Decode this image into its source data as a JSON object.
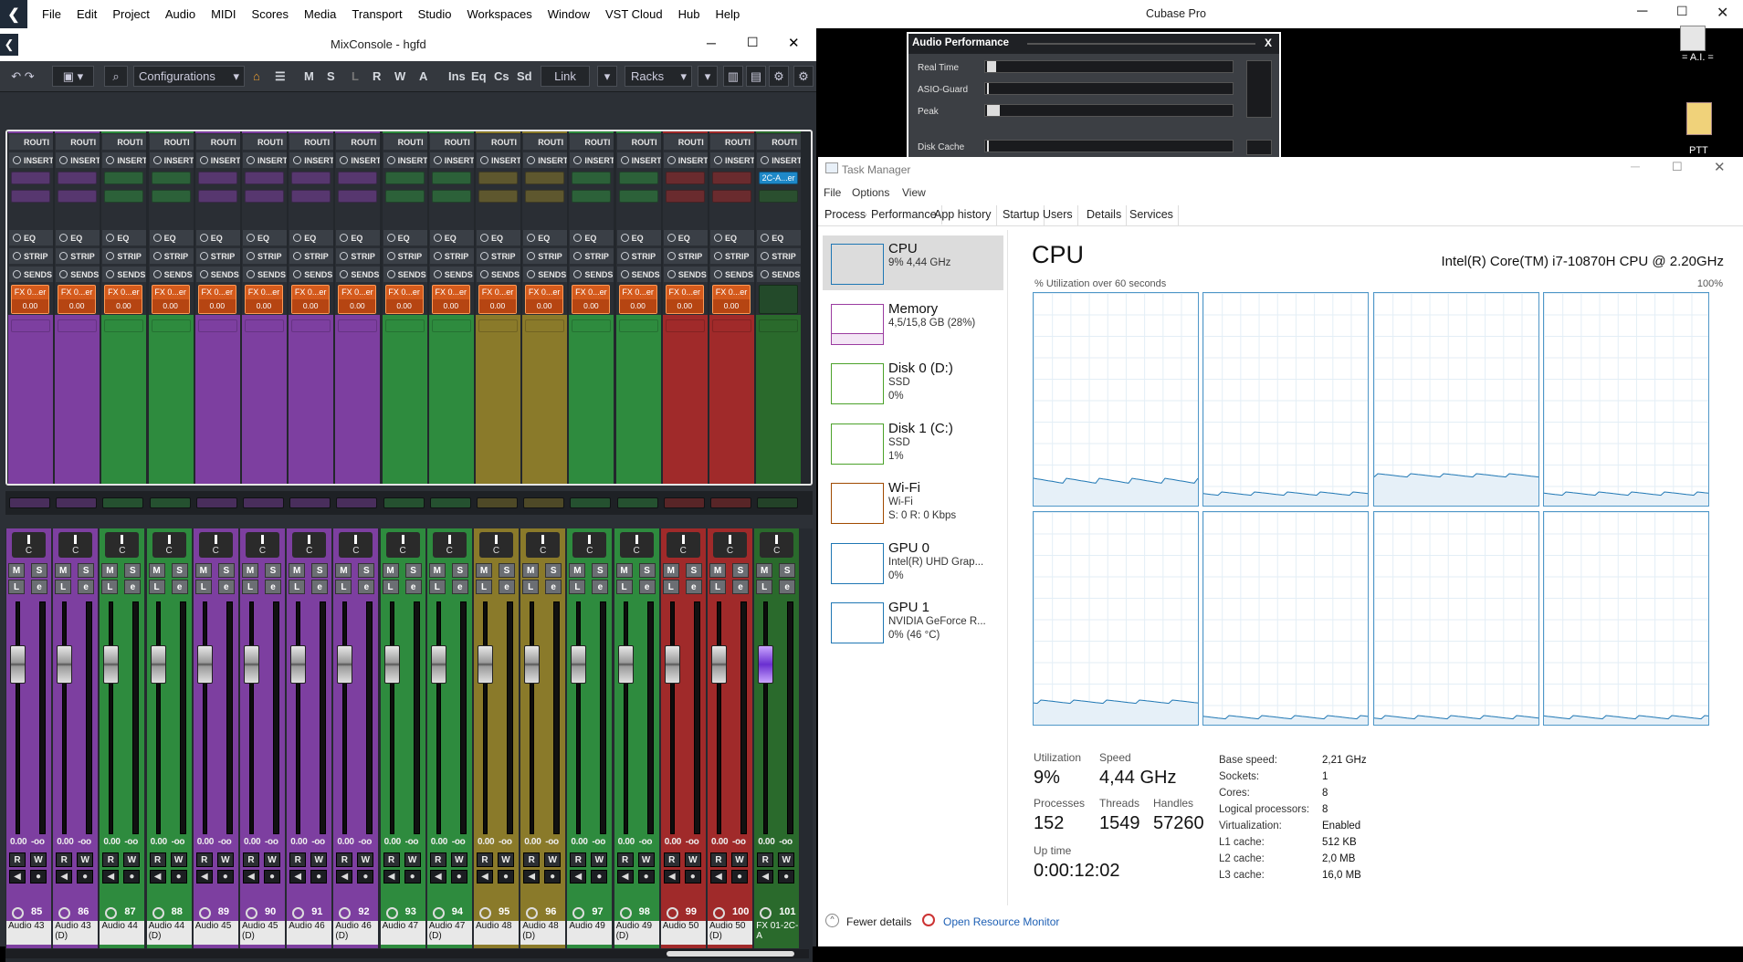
{
  "cubase": {
    "title": "Cubase Pro",
    "menu": [
      "File",
      "Edit",
      "Project",
      "Audio",
      "MIDI",
      "Scores",
      "Media",
      "Transport",
      "Studio",
      "Workspaces",
      "Window",
      "VST Cloud",
      "Hub",
      "Help"
    ]
  },
  "mixconsole": {
    "title": "MixConsole - hgfd",
    "toolbar": {
      "configurations": "Configurations",
      "m": "M",
      "s": "S",
      "l": "L",
      "r": "R",
      "w": "W",
      "a": "A",
      "ins": "Ins",
      "eq": "Eq",
      "cs": "Cs",
      "sd": "Sd",
      "link": "Link",
      "racks": "Racks"
    },
    "rack_labels": {
      "routing": "ROUTI",
      "inserts": "INSERT",
      "eq": "EQ",
      "strip": "STRIP",
      "sends": "SENDS",
      "fx_send": "FX 0...er",
      "fx_val": "0.00",
      "last_insert": "2C-A...er"
    },
    "colors": {
      "purple": "#7d3fa0",
      "green": "#2e8b3e",
      "olive": "#8a7a2a",
      "red": "#a02a2a",
      "dkgreen": "#2a6a2c"
    },
    "channels": [
      {
        "num": "85",
        "name": "Audio 43",
        "c": "purple",
        "vol": "0.00",
        "inf": "-oo"
      },
      {
        "num": "86",
        "name": "Audio 43 (D)",
        "c": "purple",
        "vol": "0.00",
        "inf": "-oo"
      },
      {
        "num": "87",
        "name": "Audio 44",
        "c": "green",
        "vol": "0.00",
        "inf": "-oo"
      },
      {
        "num": "88",
        "name": "Audio 44 (D)",
        "c": "green",
        "vol": "0.00",
        "inf": "-oo"
      },
      {
        "num": "89",
        "name": "Audio 45",
        "c": "purple",
        "vol": "0.00",
        "inf": "-oo"
      },
      {
        "num": "90",
        "name": "Audio 45 (D)",
        "c": "purple",
        "vol": "0.00",
        "inf": "-oo"
      },
      {
        "num": "91",
        "name": "Audio 46",
        "c": "purple",
        "vol": "0.00",
        "inf": "-oo"
      },
      {
        "num": "92",
        "name": "Audio 46 (D)",
        "c": "purple",
        "vol": "0.00",
        "inf": "-oo"
      },
      {
        "num": "93",
        "name": "Audio 47",
        "c": "green",
        "vol": "0.00",
        "inf": "-oo"
      },
      {
        "num": "94",
        "name": "Audio 47 (D)",
        "c": "green",
        "vol": "0.00",
        "inf": "-oo"
      },
      {
        "num": "95",
        "name": "Audio 48",
        "c": "olive",
        "vol": "0.00",
        "inf": "-oo"
      },
      {
        "num": "96",
        "name": "Audio 48 (D)",
        "c": "olive",
        "vol": "0.00",
        "inf": "-oo"
      },
      {
        "num": "97",
        "name": "Audio 49",
        "c": "green",
        "vol": "0.00",
        "inf": "-oo"
      },
      {
        "num": "98",
        "name": "Audio 49 (D)",
        "c": "green",
        "vol": "0.00",
        "inf": "-oo"
      },
      {
        "num": "99",
        "name": "Audio 50",
        "c": "red",
        "vol": "0.00",
        "inf": "-oo"
      },
      {
        "num": "100",
        "name": "Audio 50 (D)",
        "c": "red",
        "vol": "0.00",
        "inf": "-oo"
      },
      {
        "num": "101",
        "name": "FX 01-2C-A",
        "c": "dkgreen",
        "vol": "0.00",
        "inf": "-oo"
      }
    ],
    "fader_labels": {
      "pan": "C",
      "m": "M",
      "s": "S",
      "l": "L",
      "e": "e",
      "r": "R",
      "w": "W"
    }
  },
  "audio_performance": {
    "title": "Audio Performance",
    "close": "X",
    "real_time": "Real Time",
    "asio_guard": "ASIO-Guard",
    "peak": "Peak",
    "disk_cache": "Disk Cache"
  },
  "desktop": {
    "ai_label": "= A.I. =",
    "ptt_label": "PTT"
  },
  "task_manager": {
    "title": "Task Manager",
    "menu": [
      "File",
      "Options",
      "View"
    ],
    "tabs": [
      "Processes",
      "Performance",
      "App history",
      "Startup",
      "Users",
      "Details",
      "Services"
    ],
    "sidebar": [
      {
        "name": "CPU",
        "d1": "9% 4,44 GHz",
        "d2": "",
        "color": "#1f77b4"
      },
      {
        "name": "Memory",
        "d1": "4,5/15,8 GB (28%)",
        "d2": "",
        "color": "#9b3ca0"
      },
      {
        "name": "Disk 0 (D:)",
        "d1": "SSD",
        "d2": "0%",
        "color": "#4ca22a"
      },
      {
        "name": "Disk 1 (C:)",
        "d1": "SSD",
        "d2": "1%",
        "color": "#4ca22a"
      },
      {
        "name": "Wi-Fi",
        "d1": "Wi-Fi",
        "d2": "S: 0 R: 0 Kbps",
        "color": "#a04a00"
      },
      {
        "name": "GPU 0",
        "d1": "Intel(R) UHD Grap...",
        "d2": "0%",
        "color": "#1f77b4"
      },
      {
        "name": "GPU 1",
        "d1": "NVIDIA GeForce R...",
        "d2": "0% (46 °C)",
        "color": "#1f77b4"
      }
    ],
    "cpu_title": "CPU",
    "cpu_model": "Intel(R) Core(TM) i7-10870H CPU @ 2.20GHz",
    "util_label": "% Utilization over 60 seconds",
    "max": "100%",
    "stats": {
      "utilization_l": "Utilization",
      "utilization": "9%",
      "speed_l": "Speed",
      "speed": "4,44 GHz",
      "processes_l": "Processes",
      "processes": "152",
      "threads_l": "Threads",
      "threads": "1549",
      "handles_l": "Handles",
      "handles": "57260",
      "uptime_l": "Up time",
      "uptime": "0:00:12:02"
    },
    "specs": [
      [
        "Base speed:",
        "2,21 GHz"
      ],
      [
        "Sockets:",
        "1"
      ],
      [
        "Cores:",
        "8"
      ],
      [
        "Logical processors:",
        "8"
      ],
      [
        "Virtualization:",
        "Enabled"
      ],
      [
        "L1 cache:",
        "512 KB"
      ],
      [
        "L2 cache:",
        "2,0 MB"
      ],
      [
        "L3 cache:",
        "16,0 MB"
      ]
    ],
    "fewer_details": "Fewer details",
    "open_rm": "Open Resource Monitor"
  }
}
